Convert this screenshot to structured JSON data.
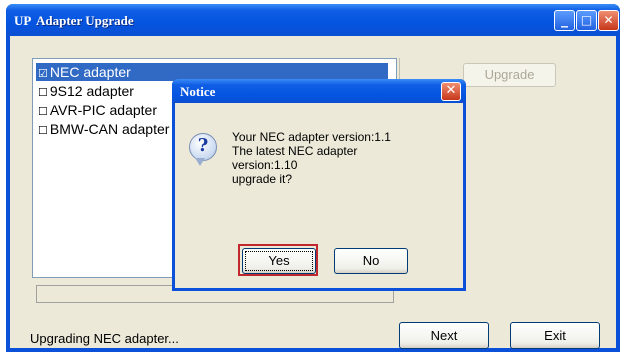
{
  "window": {
    "icon_text": "UP",
    "title": "Adapter Upgrade",
    "minimize": "_",
    "maximize": "□",
    "close": "✕"
  },
  "list": {
    "items": [
      {
        "label": "NEC adapter",
        "checked": true
      },
      {
        "label": "9S12 adapter",
        "checked": false
      },
      {
        "label": "AVR-PIC adapter",
        "checked": false
      },
      {
        "label": "BMW-CAN adapter",
        "checked": false
      }
    ]
  },
  "buttons": {
    "upgrade": "Upgrade",
    "next": "Next",
    "exit": "Exit"
  },
  "status": "Upgrading NEC adapter...",
  "dialog": {
    "title": "Notice",
    "close": "✕",
    "icon": "question-icon",
    "message": [
      "Your NEC adapter version:1.1",
      "The latest NEC adapter",
      "version:1.10",
      "upgrade it?"
    ],
    "yes": "Yes",
    "no": "No"
  },
  "colors": {
    "titlebar": "#0554e0",
    "selection": "#316ac5",
    "focus_highlight": "#c0282e"
  }
}
